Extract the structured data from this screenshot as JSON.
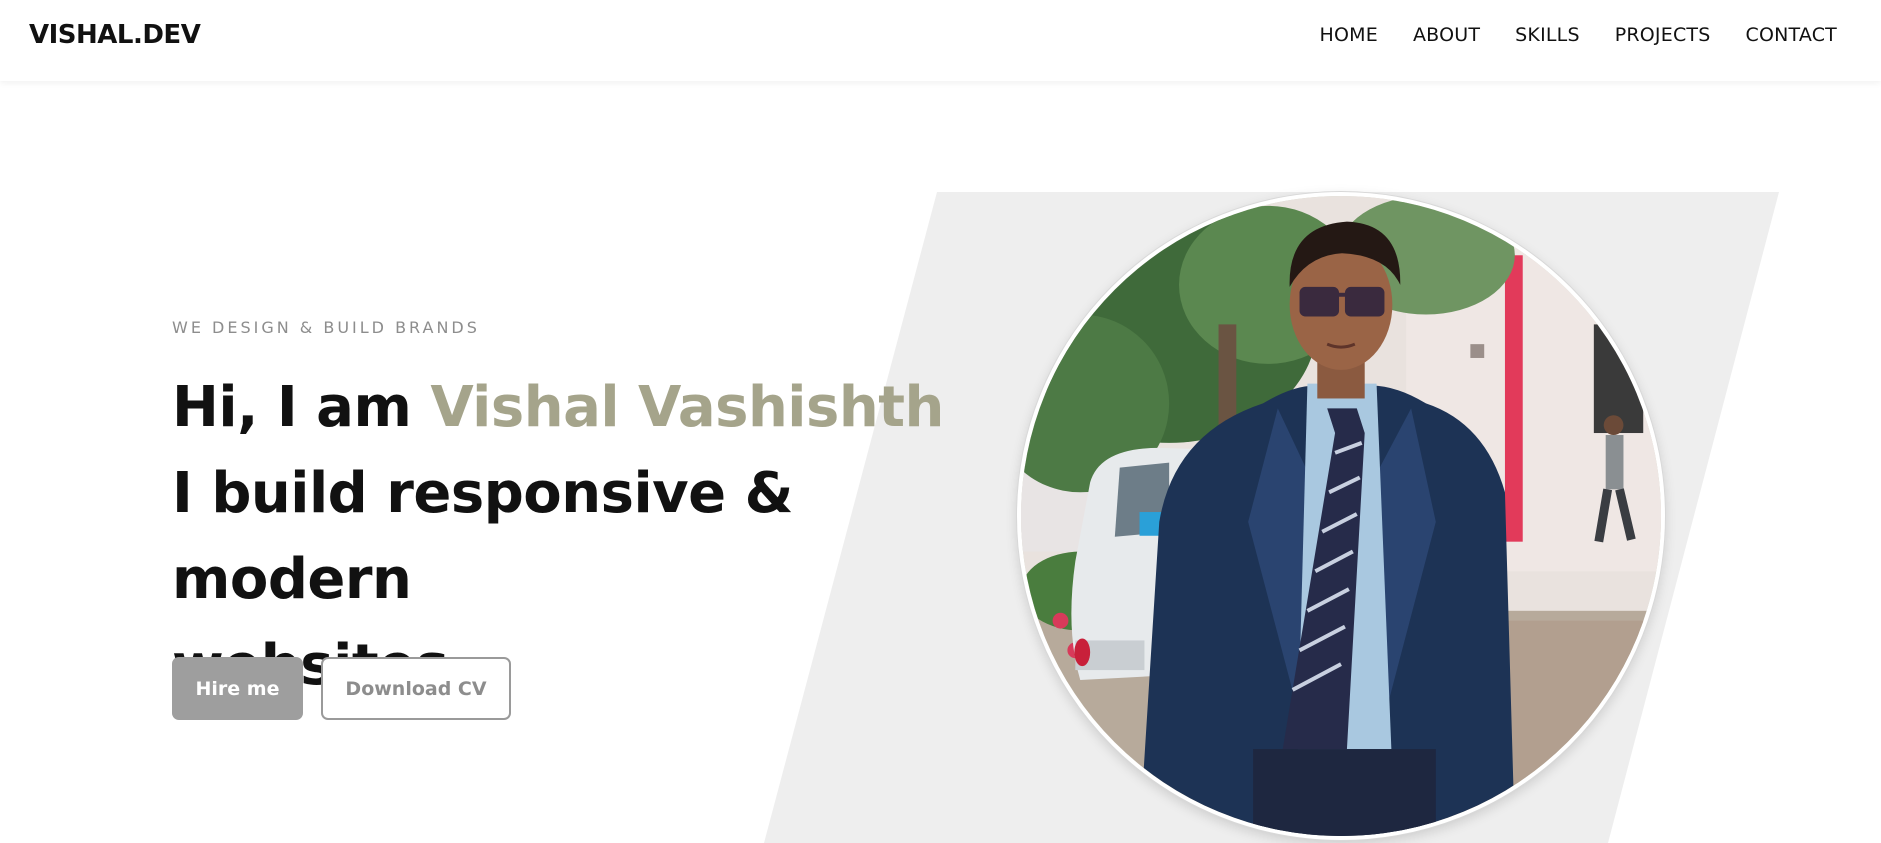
{
  "header": {
    "logo": "VISHAL.DEV",
    "nav": [
      "HOME",
      "ABOUT",
      "SKILLS",
      "PROJECTS",
      "CONTACT"
    ]
  },
  "hero": {
    "tagline": "WE DESIGN & BUILD BRANDS",
    "greeting": "Hi, I am ",
    "name": "Vishal Vashishth",
    "line2": "I build responsive & modern",
    "line3": "websites.",
    "hire_button": "Hire me",
    "cv_button": "Download CV"
  },
  "portrait": {
    "icon": "profile-photo"
  },
  "colors": {
    "accent": "#a5a48b",
    "panel": "#eeeeee",
    "primary_button": "#9e9e9e"
  }
}
